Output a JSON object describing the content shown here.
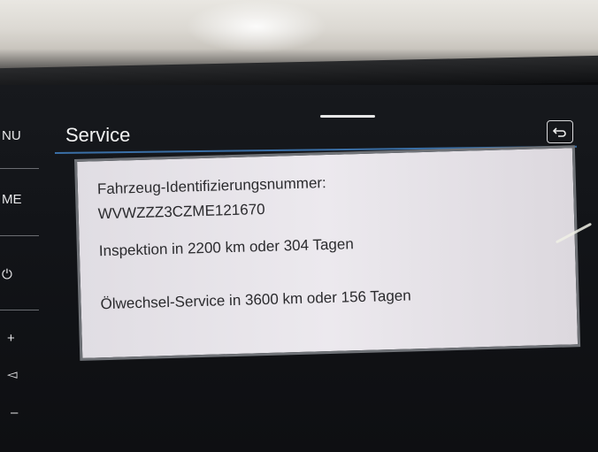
{
  "sidebar": {
    "items": [
      {
        "label": "NU"
      },
      {
        "label": "ME"
      },
      {
        "label": "⏻"
      },
      {
        "label": "+"
      },
      {
        "label": "◅"
      },
      {
        "label": "–"
      }
    ]
  },
  "header": {
    "title": "Service"
  },
  "service": {
    "vin_label": "Fahrzeug-Identifizierungsnummer:",
    "vin_value": "WVWZZZ3CZME121670",
    "inspection": "Inspektion in 2200 km oder 304 Tagen",
    "oil_service": "Ölwechsel-Service in 3600 km oder 156 Tagen"
  },
  "colors": {
    "accent_line": "#3a6fa6",
    "panel_bg": "#e6e3e8",
    "screen_bg": "#121418"
  },
  "icons": {
    "back": "back-arrow-icon"
  }
}
